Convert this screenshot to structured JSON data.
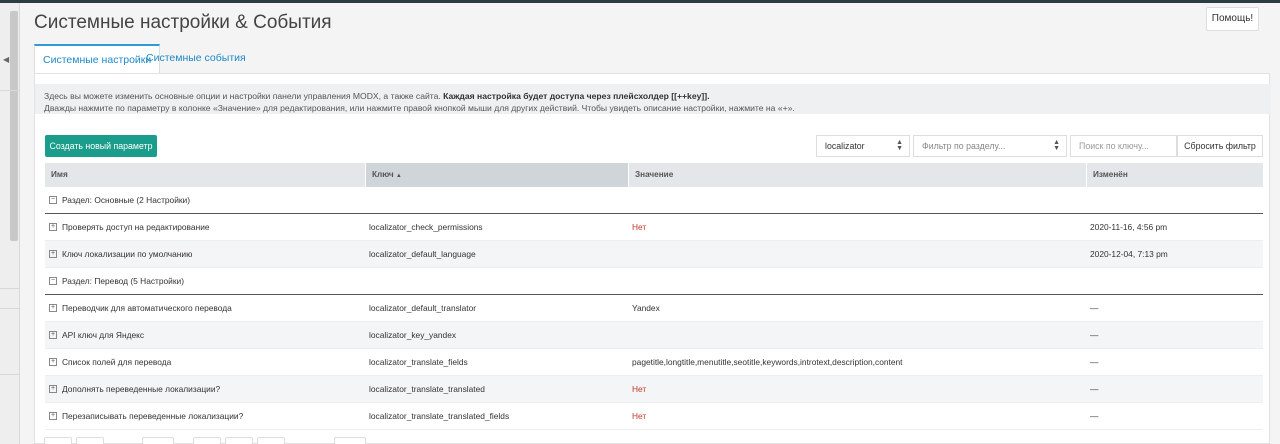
{
  "page": {
    "title": "Системные настройки & События",
    "help_label": "Помощь!"
  },
  "tabs": [
    {
      "label": "Системные настройки"
    },
    {
      "label": "Системные события"
    }
  ],
  "description": {
    "line1_normal": "Здесь вы можете изменить основные опции и настройки панели управления MODX, а также сайта. ",
    "line1_bold": "Каждая настройка будет доступа через плейсхолдер [[++key]].",
    "line2": "Дважды нажмите по параметру в колонке «Значение» для редактирования, или нажмите правой кнопкой мыши для других действий. Чтобы увидеть описание настройки, нажмите на «+»."
  },
  "toolbar": {
    "create_label": "Создать новый параметр",
    "namespace_value": "localizator",
    "area_placeholder": "Фильтр по разделу...",
    "search_placeholder": "Поиск по ключу...",
    "reset_label": "Сбросить фильтр"
  },
  "columns": {
    "name": "Имя",
    "key": "Ключ",
    "value": "Значение",
    "modified": "Изменён"
  },
  "groups": [
    {
      "label": "Раздел: Основные (2 Настройки)",
      "rows": [
        {
          "name": "Проверять доступ на редактирование",
          "key": "localizator_check_permissions",
          "value": "Нет",
          "modified": "2020-11-16, 4:56 pm"
        },
        {
          "name": "Ключ локализации по умолчанию",
          "key": "localizator_default_language",
          "value": "",
          "modified": "2020-12-04, 7:13 pm"
        }
      ]
    },
    {
      "label": "Раздел: Перевод (5 Настройки)",
      "rows": [
        {
          "name": "Переводчик для автоматического перевода",
          "key": "localizator_default_translator",
          "value": "Yandex",
          "modified": "—"
        },
        {
          "name": "API ключ для Яндекс",
          "key": "localizator_key_yandex",
          "value": "",
          "modified": "—"
        },
        {
          "name": "Список полей для перевода",
          "key": "localizator_translate_fields",
          "value": "pagetitle,longtitle,menutitle,seotitle,keywords,introtext,description,content",
          "modified": "—"
        },
        {
          "name": "Дополнять переведенные локализации?",
          "key": "localizator_translate_translated",
          "value": "Нет",
          "modified": "—"
        },
        {
          "name": "Перезаписывать переведенные локализации?",
          "key": "localizator_translate_translated_fields",
          "value": "Нет",
          "modified": "—"
        }
      ]
    }
  ],
  "colors": {
    "accent": "#1a9d8b",
    "link": "#1e88c7",
    "no_value": "#c0392b"
  }
}
